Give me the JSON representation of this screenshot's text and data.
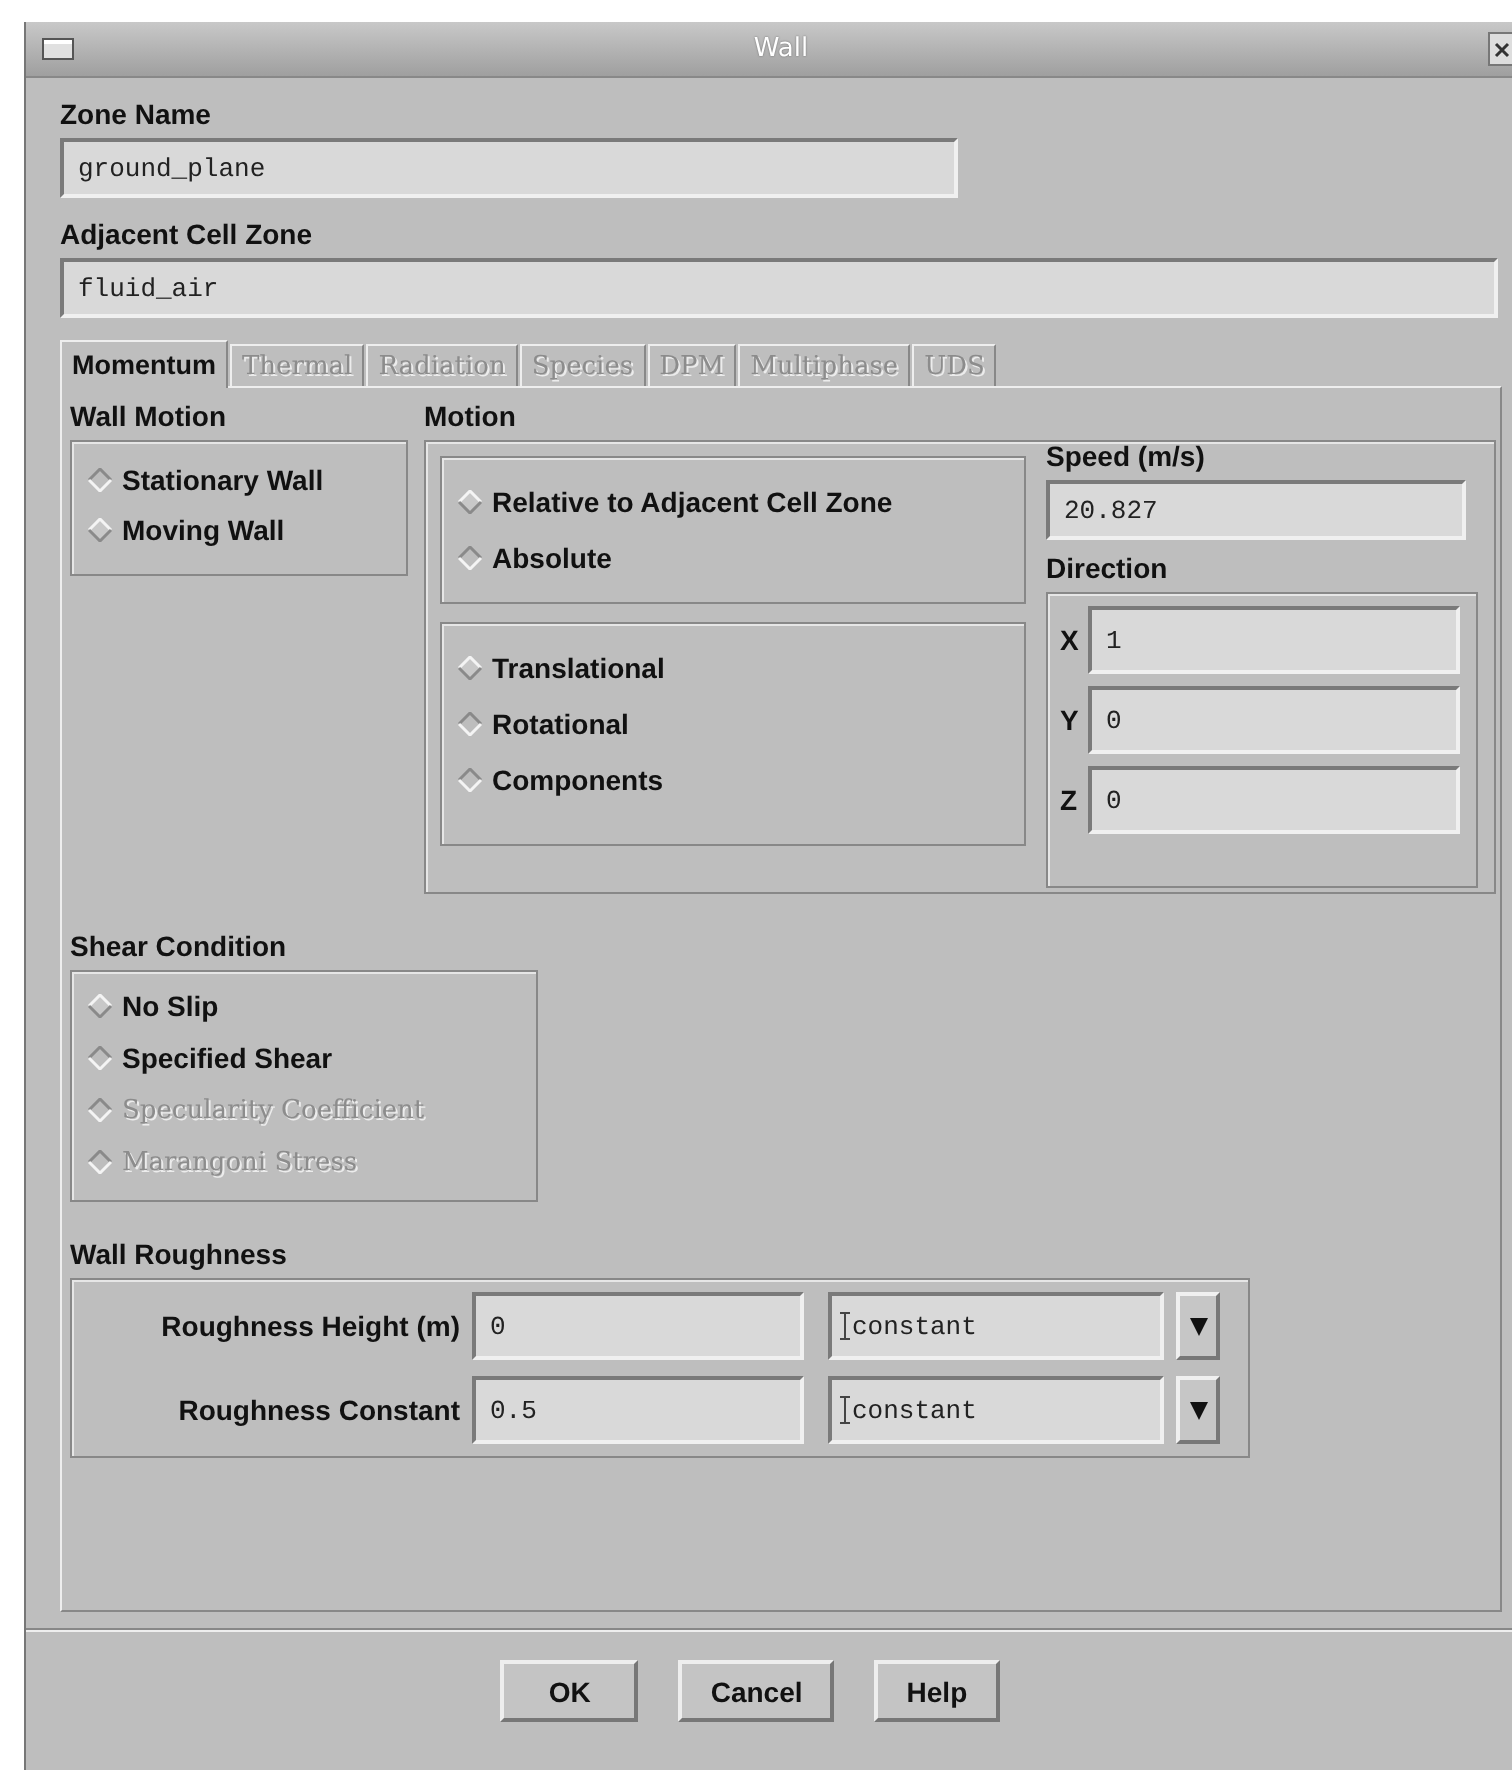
{
  "window": {
    "title": "Wall"
  },
  "zone_name": {
    "label": "Zone Name",
    "value": "ground_plane"
  },
  "adjacent_cell_zone": {
    "label": "Adjacent Cell Zone",
    "value": "fluid_air"
  },
  "tabs": [
    {
      "label": "Momentum",
      "selected": true,
      "disabled": false
    },
    {
      "label": "Thermal",
      "selected": false,
      "disabled": true
    },
    {
      "label": "Radiation",
      "selected": false,
      "disabled": true
    },
    {
      "label": "Species",
      "selected": false,
      "disabled": true
    },
    {
      "label": "DPM",
      "selected": false,
      "disabled": true
    },
    {
      "label": "Multiphase",
      "selected": false,
      "disabled": true
    },
    {
      "label": "UDS",
      "selected": false,
      "disabled": true
    }
  ],
  "wall_motion": {
    "label": "Wall Motion",
    "options": [
      {
        "label": "Stationary Wall",
        "selected": false
      },
      {
        "label": "Moving Wall",
        "selected": true
      }
    ]
  },
  "motion": {
    "label": "Motion",
    "reference": [
      {
        "label": "Relative to Adjacent Cell Zone",
        "selected": true
      },
      {
        "label": "Absolute",
        "selected": false
      }
    ],
    "type": [
      {
        "label": "Translational",
        "selected": true
      },
      {
        "label": "Rotational",
        "selected": false
      },
      {
        "label": "Components",
        "selected": false
      }
    ]
  },
  "speed": {
    "label": "Speed (m/s)",
    "value": "20.827"
  },
  "direction": {
    "label": "Direction",
    "components": [
      {
        "label": "X",
        "value": "1"
      },
      {
        "label": "Y",
        "value": "0"
      },
      {
        "label": "Z",
        "value": "0"
      }
    ]
  },
  "shear_condition": {
    "label": "Shear Condition",
    "options": [
      {
        "label": "No Slip",
        "selected": true,
        "disabled": false
      },
      {
        "label": "Specified Shear",
        "selected": false,
        "disabled": false
      },
      {
        "label": "Specularity Coefficient",
        "selected": false,
        "disabled": true
      },
      {
        "label": "Marangoni Stress",
        "selected": false,
        "disabled": true
      }
    ]
  },
  "wall_roughness": {
    "label": "Wall Roughness",
    "rows": [
      {
        "label": "Roughness Height (m)",
        "value": "0",
        "method": "constant"
      },
      {
        "label": "Roughness Constant",
        "value": "0.5",
        "method": "constant"
      }
    ]
  },
  "buttons": [
    "OK",
    "Cancel",
    "Help"
  ]
}
